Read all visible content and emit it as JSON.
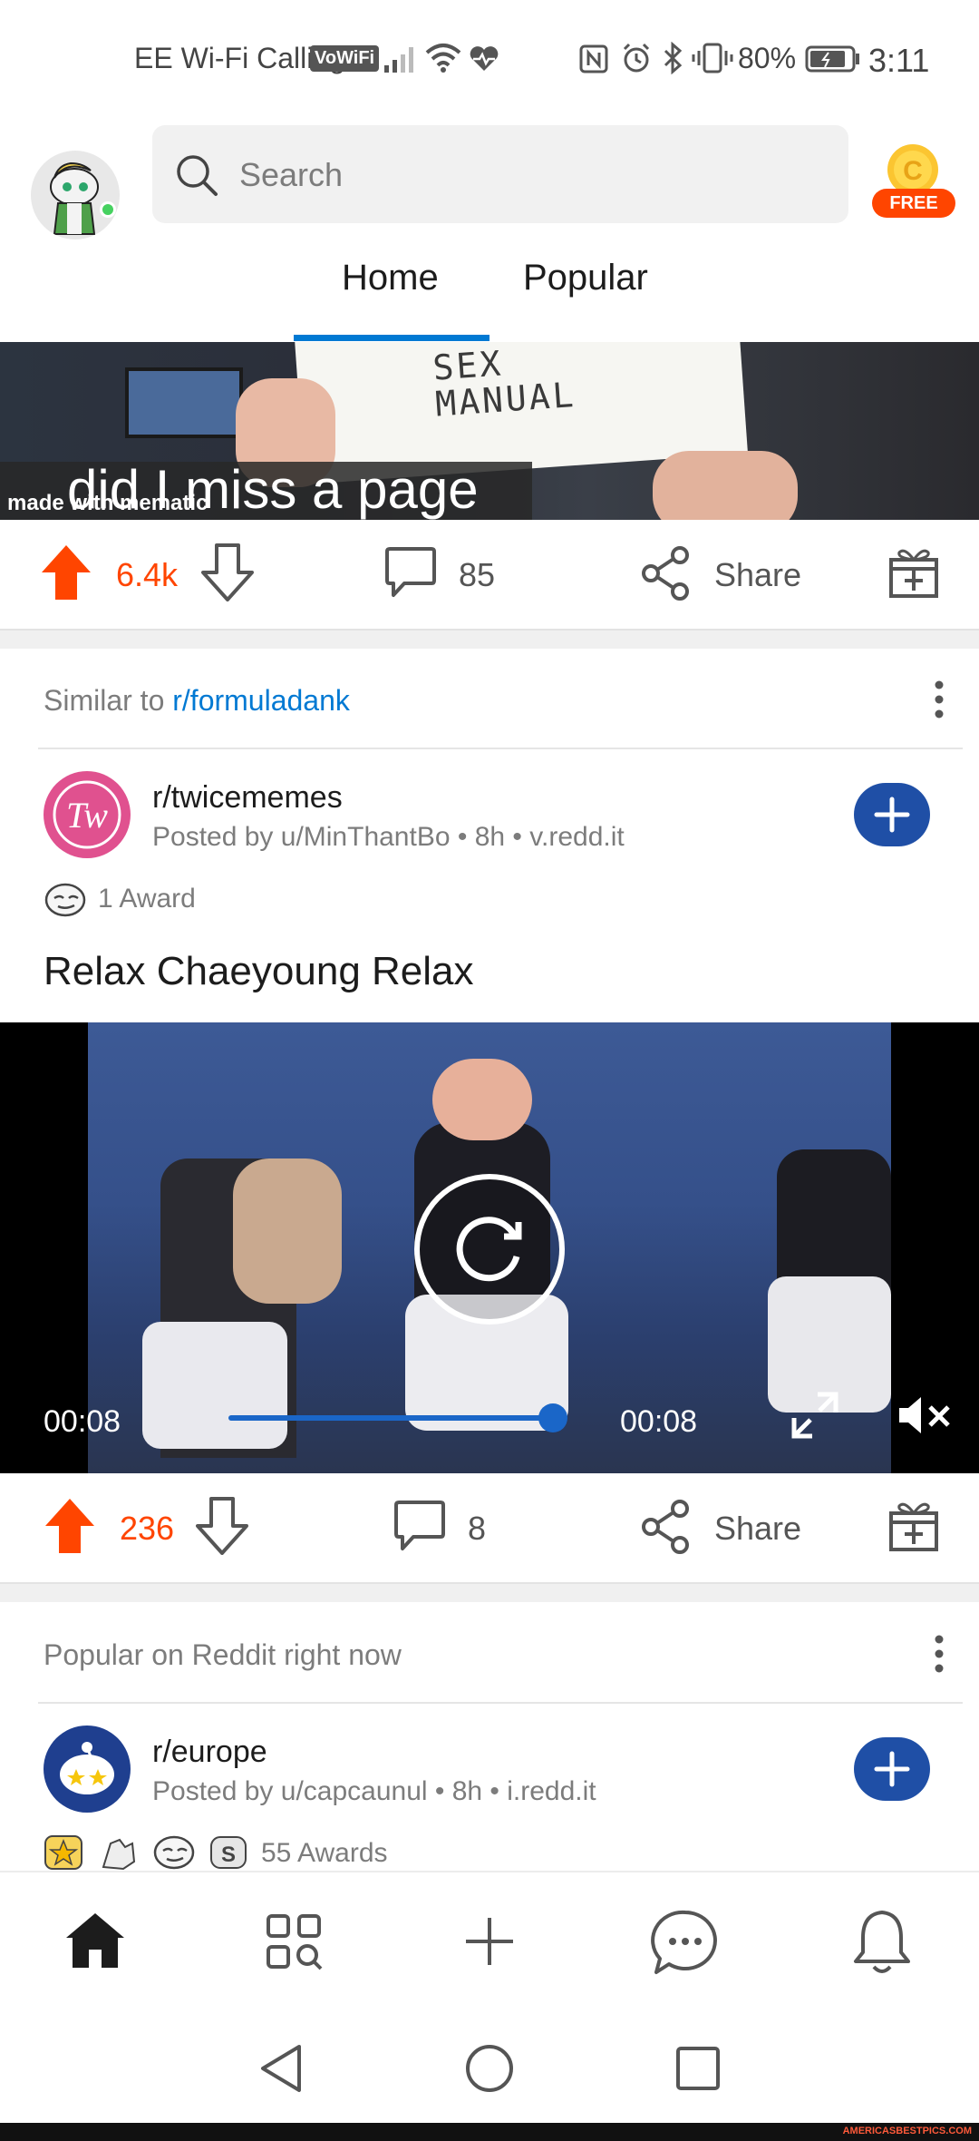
{
  "status_bar": {
    "carrier": "EE Wi-Fi Calling",
    "vowifi_badge": "VoWiFi",
    "battery": "80%",
    "time": "3:11"
  },
  "header": {
    "search_placeholder": "Search",
    "coin_badge": "FREE"
  },
  "tabs": [
    {
      "label": "Home",
      "active": true
    },
    {
      "label": "Popular",
      "active": false
    }
  ],
  "post1": {
    "media_caption": "did I miss a page",
    "media_paper_text": "SEX MANUAL",
    "media_watermark": "made with mematic",
    "score": "6.4k",
    "comments": "85",
    "share_label": "Share"
  },
  "post2": {
    "context_prefix": "Similar to",
    "context_link": "r/formuladank",
    "subreddit": "r/twicememes",
    "meta": "Posted by u/MinThantBo • 8h • v.redd.it",
    "awards": "1 Award",
    "title": "Relax Chaeyoung Relax",
    "video_time_left": "00:08",
    "video_time_right": "00:08",
    "video_progress": 1.0,
    "score": "236",
    "comments": "8",
    "share_label": "Share"
  },
  "post3": {
    "context": "Popular on Reddit right now",
    "subreddit": "r/europe",
    "meta": "Posted by u/capcaunul • 8h • i.redd.it",
    "awards": "55 Awards"
  },
  "bottom_nav": [
    "home-icon",
    "discover-icon",
    "create-icon",
    "chat-icon",
    "notifications-icon"
  ],
  "watermark": "AMERICASBESTPICS.COM",
  "colors": {
    "upvote": "#ff4500",
    "accent_blue": "#0079d3",
    "join_button": "#1f4fa6"
  }
}
